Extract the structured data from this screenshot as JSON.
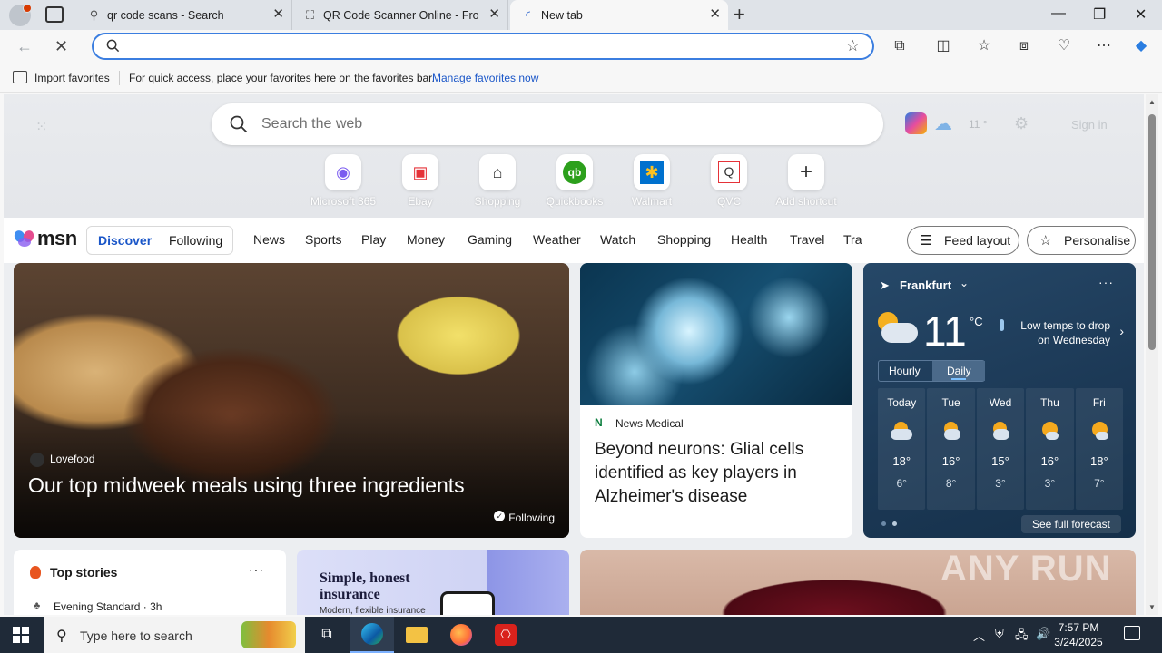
{
  "browser": {
    "tabs": [
      {
        "title": "qr code scans - Search",
        "icon": "search-icon"
      },
      {
        "title": "QR Code Scanner Online - From",
        "icon": "qr-scanner-icon"
      },
      {
        "title": "New tab",
        "icon": "loading-spinner-icon"
      }
    ],
    "address_value": "",
    "favorites_bar": {
      "import_label": "Import favorites",
      "message": "For quick access, place your favorites here on the favorites bar.",
      "manage_link": "Manage favorites now"
    }
  },
  "newtab": {
    "search_placeholder": "Search the web",
    "weather_mini": "11 °",
    "signin_label": "Sign in",
    "shortcuts": [
      {
        "label": "Microsoft 365",
        "glyph": "◉",
        "color": "#7b5cf0"
      },
      {
        "label": "Ebay",
        "glyph": "▣",
        "color": "#e53238"
      },
      {
        "label": "Shopping",
        "glyph": "⌂",
        "color": "#333333"
      },
      {
        "label": "Quickbooks",
        "glyph": "qb",
        "color": "#2ca01c"
      },
      {
        "label": "Walmart",
        "glyph": "✱",
        "color": "#ffc220"
      },
      {
        "label": "QVC",
        "glyph": "Q",
        "color": "#333333"
      },
      {
        "label": "Add shortcut",
        "glyph": "+",
        "color": "#333333"
      }
    ]
  },
  "msn": {
    "logo": "msn",
    "pills": [
      "Discover",
      "Following"
    ],
    "nav": [
      "News",
      "Sports",
      "Play",
      "Money",
      "Gaming",
      "Weather",
      "Watch",
      "Shopping",
      "Health",
      "Travel",
      "Tra"
    ],
    "feed_layout": "Feed layout",
    "personalise": "Personalise"
  },
  "cards": {
    "food": {
      "source": "Lovefood",
      "headline": "Our top midweek meals using three ingredients",
      "follow": "Following"
    },
    "neuro": {
      "source": "News Medical",
      "source_icon": "N",
      "headline": "Beyond neurons: Glial cells identified as key players in Alzheimer's disease"
    },
    "weather": {
      "location": "Frankfurt",
      "temp": "11",
      "unit": "°C",
      "alert": "Low temps to drop on Wednesday",
      "toggle": [
        "Hourly",
        "Daily"
      ],
      "days": [
        {
          "name": "Today",
          "hi": "18°",
          "lo": "6°"
        },
        {
          "name": "Tue",
          "hi": "16°",
          "lo": "8°"
        },
        {
          "name": "Wed",
          "hi": "15°",
          "lo": "3°"
        },
        {
          "name": "Thu",
          "hi": "16°",
          "lo": "3°"
        },
        {
          "name": "Fri",
          "hi": "18°",
          "lo": "7°"
        }
      ],
      "forecast_button": "See full forecast"
    },
    "topstories": {
      "title": "Top stories",
      "source": "Evening Standard · 3h"
    },
    "ad": {
      "line1": "Simple, honest insurance",
      "line2": "Modern, flexible insurance"
    }
  },
  "watermark": "ANY RUN",
  "taskbar": {
    "search_placeholder": "Type here to search",
    "time": "7:57 PM",
    "date": "3/24/2025"
  },
  "colors": {
    "accent": "#1a56c8",
    "address_border": "#3b7ee0",
    "taskbar": "#1f2a38"
  }
}
